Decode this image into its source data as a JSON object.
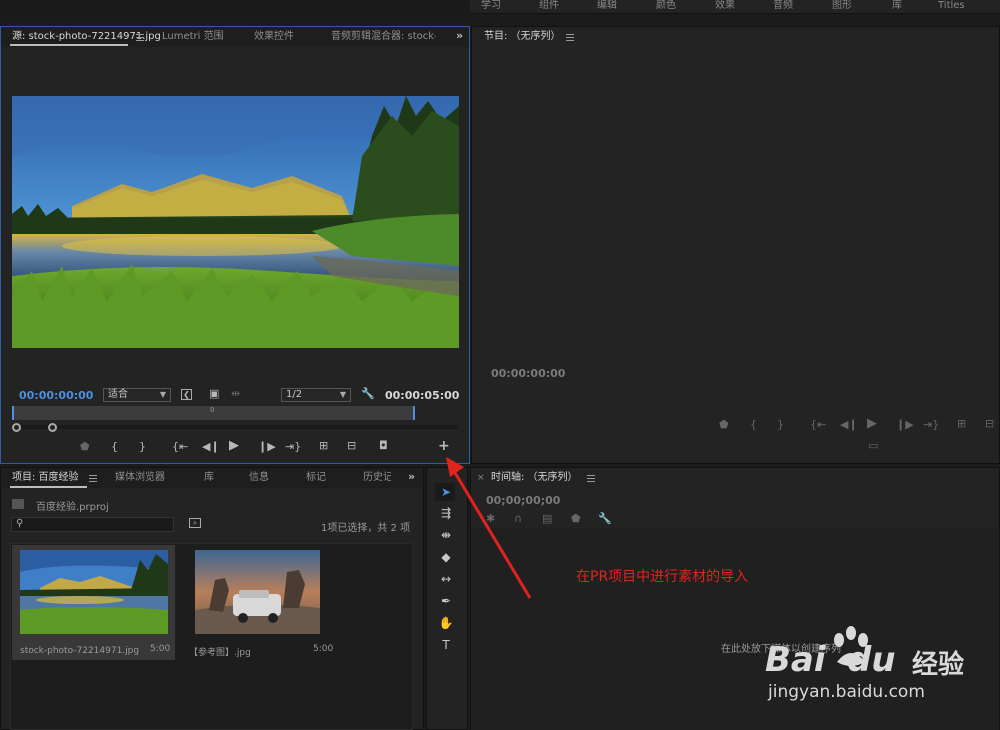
{
  "workspace_tabs": [
    "学习",
    "组件",
    "编辑",
    "颜色",
    "效果",
    "音频",
    "图形",
    "库",
    "Titles"
  ],
  "source_monitor": {
    "tabs": [
      "源: stock-photo-72214971.jpg",
      "Lumetri 范围",
      "效果控件",
      "音频剪辑混合器: stock-"
    ],
    "timecode_in": "00:00:00:00",
    "timecode_duration": "00:00:05:00",
    "zoom_select": "适合",
    "resolution_select": "1/2",
    "ruler_marker": "0"
  },
  "program_monitor": {
    "title": "节目: （无序列）",
    "timecode": "00:00:00:00"
  },
  "project_panel": {
    "tabs": [
      "项目: 百度经验",
      "媒体浏览器",
      "库",
      "信息",
      "标记",
      "历史记"
    ],
    "file_name": "百度经验.prproj",
    "selection_status": "1项已选择，共 2 项",
    "items": [
      {
        "name": "stock-photo-72214971.jpg",
        "duration": "5:00"
      },
      {
        "name": "【参考图】.jpg",
        "duration": "5:00"
      }
    ]
  },
  "timeline": {
    "title": "时间轴: （无序列）",
    "timecode": "00;00;00;00",
    "drop_hint": "在此处放下媒体以创建序列"
  },
  "annotation": "在PR项目中进行素材的导入",
  "watermark": {
    "brand_left": "Bai",
    "brand_right": "du",
    "brand_cn": "经验",
    "url": "jingyan.baidu.com"
  },
  "colors": {
    "accent_blue": "#4f8fe0",
    "annotation_red": "#e0231d",
    "panel_bg": "#232323"
  }
}
